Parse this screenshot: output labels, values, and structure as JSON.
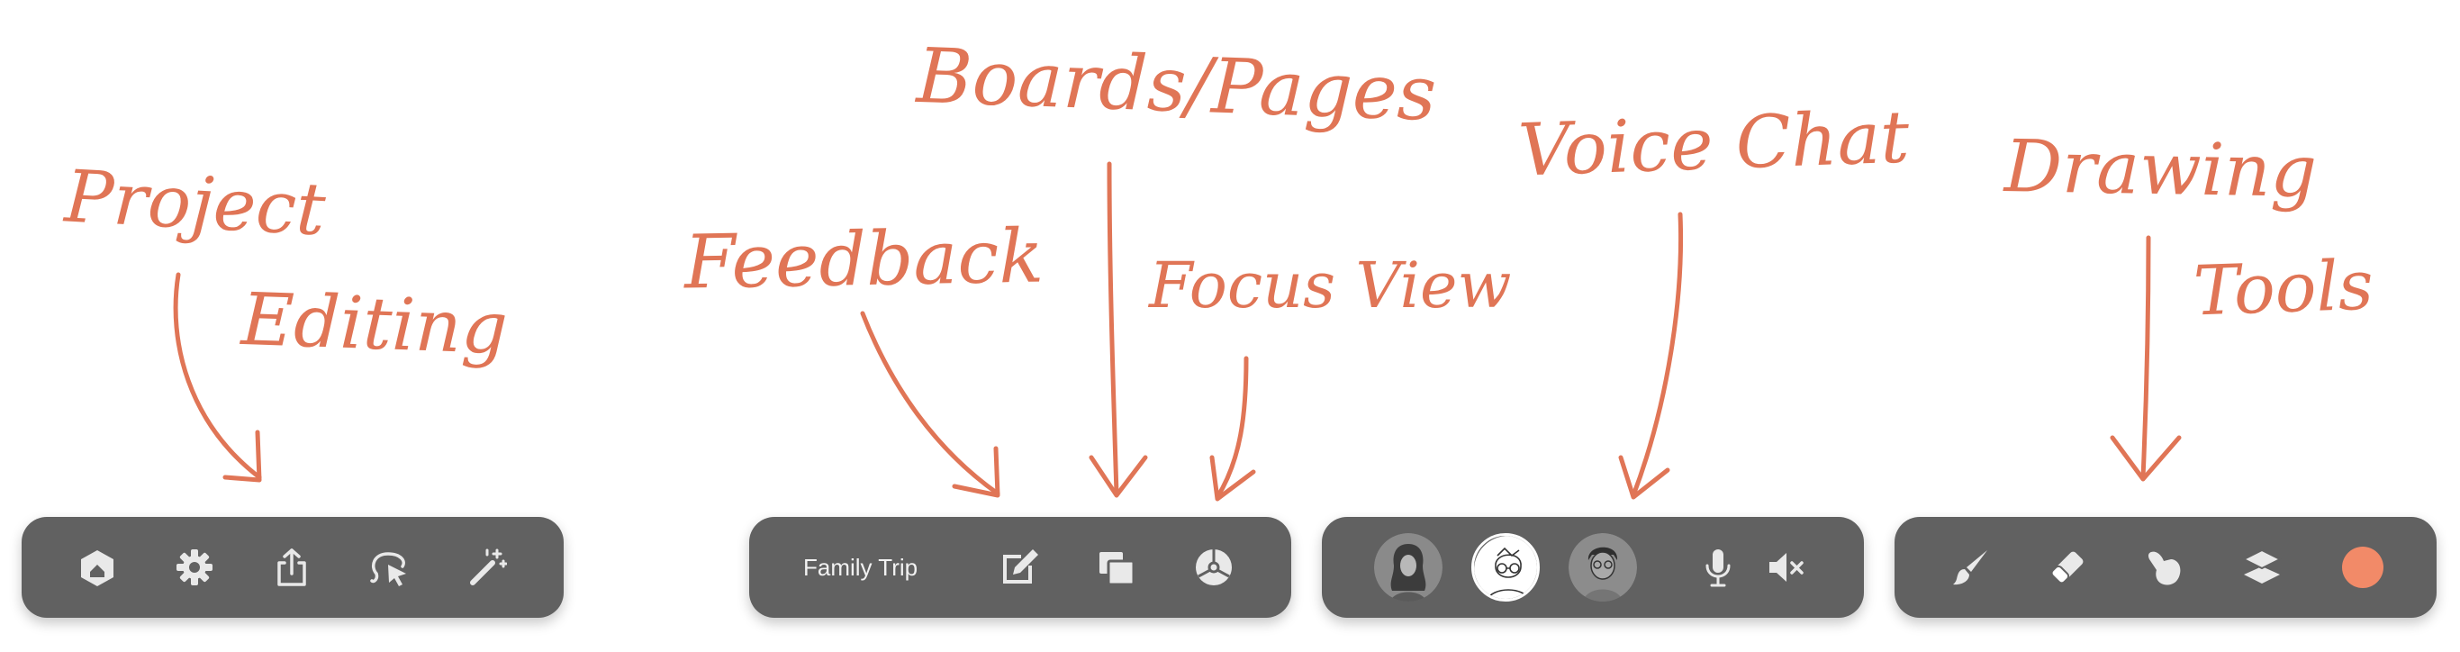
{
  "annotations": {
    "project": "Project",
    "editing": "Editing",
    "feedback": "Feedback",
    "boards_pages": "Boards/Pages",
    "focus_view": "Focus View",
    "voice_chat": "Voice Chat",
    "drawing": "Drawing",
    "tools": "Tools"
  },
  "colors": {
    "annotation": "#e07556",
    "toolbar": "#616161",
    "icon": "#e9e9e9",
    "current_color": "#f28a68"
  },
  "project_toolbar": {
    "icons": [
      "home-icon",
      "gear-icon",
      "share-icon",
      "lasso-select-icon",
      "magic-wand-icon"
    ]
  },
  "board_toolbar": {
    "title": "Family Trip",
    "icons": [
      "feedback-note-icon",
      "pages-icon",
      "focus-view-icon"
    ]
  },
  "voice_toolbar": {
    "participants": [
      "participant-1",
      "participant-2",
      "participant-3"
    ],
    "icons": [
      "microphone-icon",
      "speaker-mute-icon"
    ]
  },
  "drawing_toolbar": {
    "icons": [
      "brush-icon",
      "eraser-icon",
      "smudge-icon",
      "layers-icon"
    ],
    "current_color": "#f28a68"
  }
}
